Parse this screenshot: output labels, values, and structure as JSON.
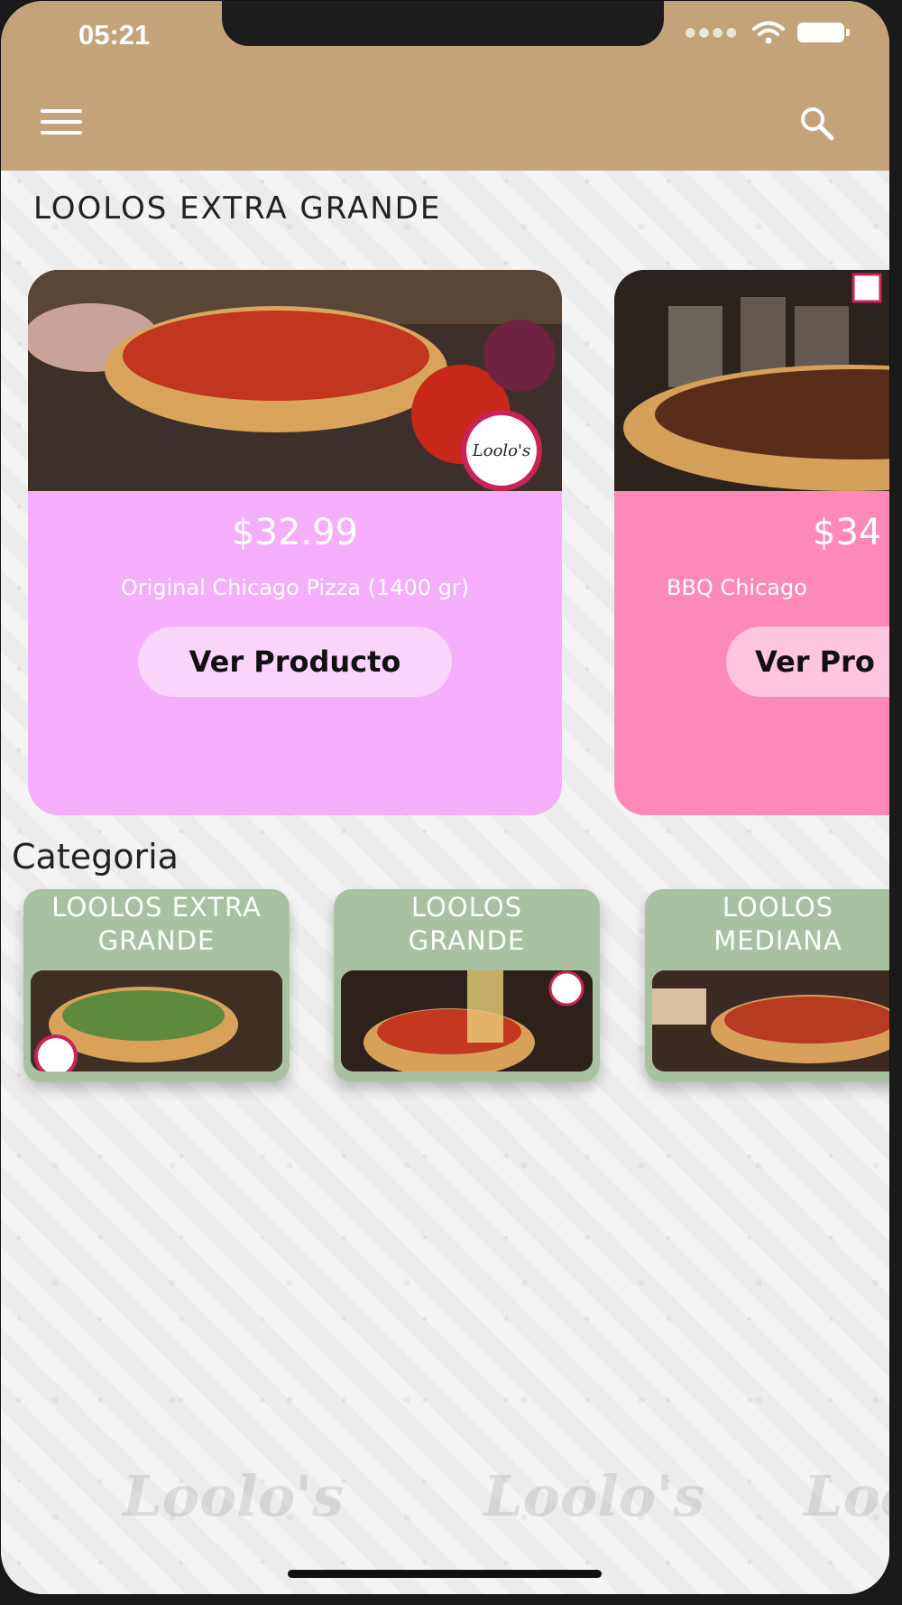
{
  "status": {
    "time": "05:21"
  },
  "section": {
    "title": "LOOLOS EXTRA GRANDE"
  },
  "products": [
    {
      "price": "$32.99",
      "name": "Original Chicago Pizza (1400 gr)",
      "button": "Ver Producto",
      "color": "#f4aefc"
    },
    {
      "price": "$34",
      "name": "BBQ Chicago",
      "button": "Ver Pro",
      "color": "#fd89b9"
    }
  ],
  "categories": {
    "title": "Categoria",
    "items": [
      {
        "line1": "LOOLOS EXTRA",
        "line2": "GRANDE"
      },
      {
        "line1": "LOOLOS",
        "line2": "GRANDE"
      },
      {
        "line1": "LOOLOS",
        "line2": "MEDIANA"
      }
    ]
  },
  "colors": {
    "appbar": "#c4a27a",
    "category_card": "#a9c1a2"
  },
  "icons": [
    "menu-icon",
    "search-icon",
    "wifi-icon",
    "battery-icon"
  ]
}
